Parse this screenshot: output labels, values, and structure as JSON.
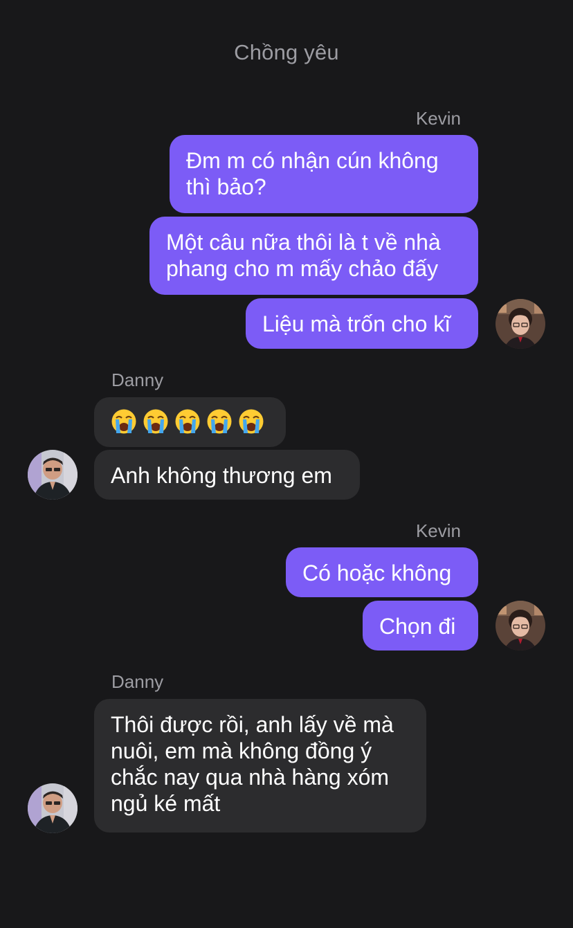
{
  "conversation": {
    "title": "Chồng yêu"
  },
  "groups": [
    {
      "sender": "Kevin",
      "messages": [
        "Đm m có nhận cún không thì bảo?",
        "Một câu nữa thôi là t về nhà phang cho m mấy chảo đấy",
        "Liệu mà trốn cho kĩ"
      ]
    },
    {
      "sender": "Danny",
      "messages": [
        "crying-face-emoji x5",
        "Anh không thương em"
      ]
    },
    {
      "sender": "Kevin",
      "messages": [
        "Có hoặc không",
        "Chọn đi"
      ]
    },
    {
      "sender": "Danny",
      "messages": [
        "Thôi được rồi, anh lấy về mà nuôi, em mà không đồng ý chắc nay qua nhà hàng xóm ngủ ké mất"
      ]
    }
  ],
  "icons": {
    "emoji": "loudly-crying-face-icon",
    "avatar_kevin": "kevin-avatar",
    "avatar_danny": "danny-avatar"
  },
  "colors": {
    "background": "#18181a",
    "outgoing_bubble": "#7c5cf6",
    "incoming_bubble": "#2c2c2e",
    "secondary_text": "#9d9da3"
  }
}
